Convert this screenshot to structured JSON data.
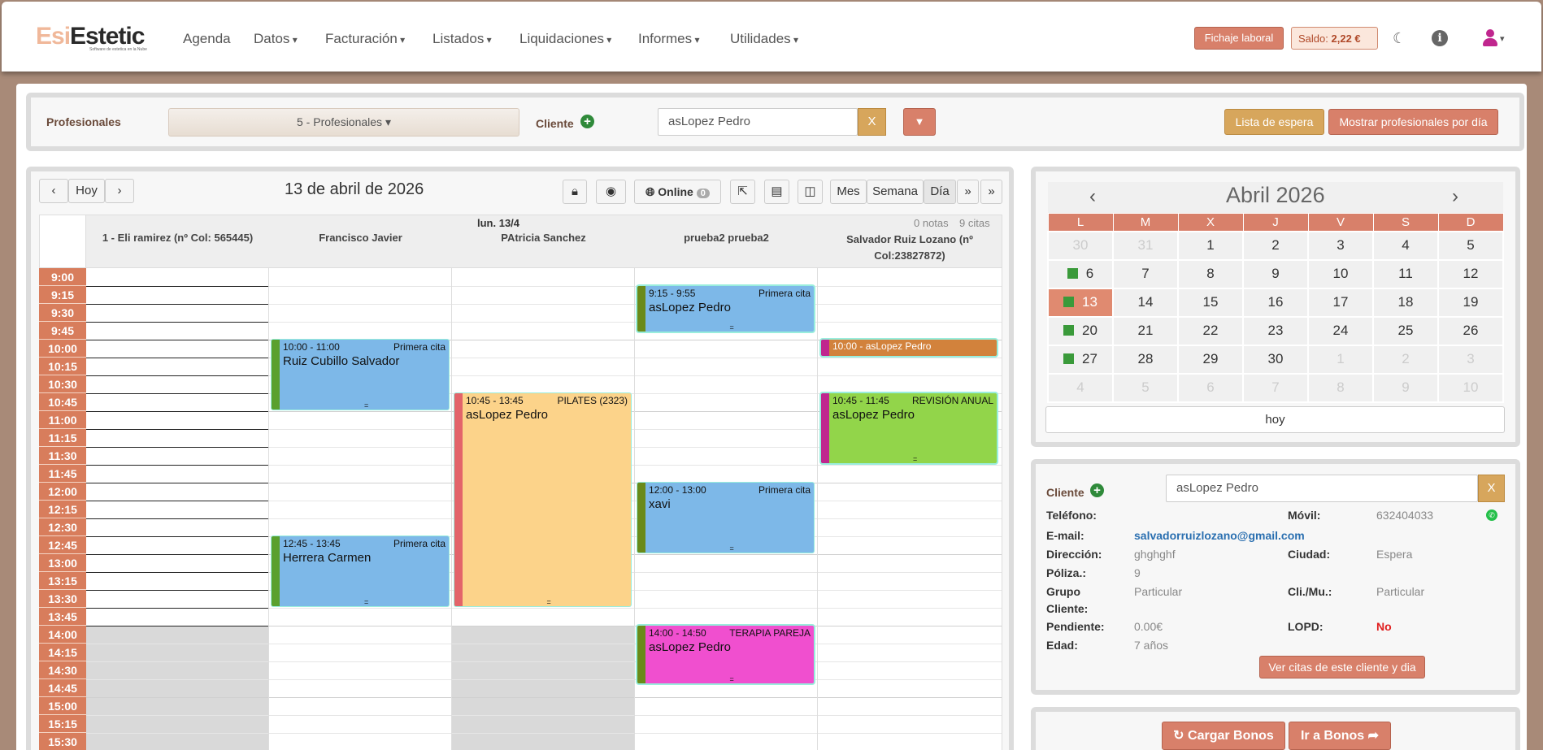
{
  "header": {
    "logo_a": "Esi",
    "logo_b": "Estetic",
    "logo_sub": "Software de estetica en la Nube",
    "nav": [
      "Agenda",
      "Datos",
      "Facturación",
      "Listados",
      "Liquidaciones",
      "Informes",
      "Utilidades"
    ],
    "fichaje": "Fichaje laboral",
    "saldo_label": "Saldo:",
    "saldo_value": "2,22 €"
  },
  "filter": {
    "profesionales_label": "Profesionales",
    "profesionales_select": "5 - Profesionales",
    "cliente_label": "Cliente",
    "cliente_value": "asLopez Pedro",
    "x": "X",
    "lista_espera": "Lista de espera",
    "mostrar": "Mostrar profesionales por día"
  },
  "agenda": {
    "hoy": "Hoy",
    "date_title": "13 de abril de 2026",
    "online": "Online",
    "online_count": "0",
    "views": [
      "Mes",
      "Semana",
      "Día"
    ],
    "day_label": "lun. 13/4",
    "notas": "0 notas",
    "citas": "9 citas",
    "professionals": [
      "1 - Eli ramirez (nº Col: 565445)",
      "Francisco Javier",
      "PAtricia Sanchez",
      "prueba2 prueba2",
      "Salvador Ruiz Lozano (nº Col:23827872)"
    ],
    "times": [
      "9:00",
      "9:15",
      "9:30",
      "9:45",
      "10:00",
      "10:15",
      "10:30",
      "10:45",
      "11:00",
      "11:15",
      "11:30",
      "11:45",
      "12:00",
      "12:15",
      "12:30",
      "12:45",
      "13:00",
      "13:15",
      "13:30",
      "13:45",
      "14:00",
      "14:15",
      "14:30",
      "14:45",
      "15:00",
      "15:15",
      "15:30"
    ],
    "events": [
      {
        "time": "10:00 - 11:00",
        "tag": "Primera cita",
        "name": "Ruiz Cubillo Salvador"
      },
      {
        "time": "12:45 - 13:45",
        "tag": "Primera cita",
        "name": "Herrera Carmen"
      },
      {
        "time": "10:45 - 13:45",
        "tag": "PILATES (2323)",
        "name": "asLopez Pedro"
      },
      {
        "time": "9:15 - 9:55",
        "tag": "Primera cita",
        "name": "asLopez Pedro"
      },
      {
        "time": "12:00 - 13:00",
        "tag": "Primera cita",
        "name": "xavi"
      },
      {
        "time": "14:00 - 14:50",
        "tag": "TERAPIA PAREJA",
        "name": "asLopez Pedro"
      },
      {
        "time": "10:00 - asLopez Pedro",
        "tag": "",
        "name": ""
      },
      {
        "time": "10:45 - 11:45",
        "tag": "REVISIÓN ANUAL",
        "name": "asLopez Pedro"
      }
    ]
  },
  "minical": {
    "title": "Abril 2026",
    "prev": "‹",
    "next": "›",
    "days": [
      "L",
      "M",
      "X",
      "J",
      "V",
      "S",
      "D"
    ],
    "weeks": [
      [
        "30",
        "31",
        "1",
        "2",
        "3",
        "4",
        "5"
      ],
      [
        "6",
        "7",
        "8",
        "9",
        "10",
        "11",
        "12"
      ],
      [
        "13",
        "14",
        "15",
        "16",
        "17",
        "18",
        "19"
      ],
      [
        "20",
        "21",
        "22",
        "23",
        "24",
        "25",
        "26"
      ],
      [
        "27",
        "28",
        "29",
        "30",
        "1",
        "2",
        "3"
      ],
      [
        "4",
        "5",
        "6",
        "7",
        "8",
        "9",
        "10"
      ]
    ],
    "hoy": "hoy"
  },
  "client": {
    "label": "Cliente",
    "value": "asLopez Pedro",
    "x": "X",
    "telefono_l": "Teléfono:",
    "movil_l": "Móvil:",
    "movil_v": "632404033",
    "email_l": "E-mail:",
    "email_v": "salvadorruizlozano@gmail.com",
    "direccion_l": "Dirección:",
    "direccion_v": "ghghghf",
    "ciudad_l": "Ciudad:",
    "ciudad_v": "Espera",
    "poliza_l": "Póliza.:",
    "poliza_v": "9",
    "grupo_l1": "Grupo",
    "grupo_l2": "Cliente:",
    "grupo_v": "Particular",
    "climu_l": "Cli./Mu.:",
    "climu_v": "Particular",
    "pendiente_l": "Pendiente:",
    "pendiente_v": "0.00€",
    "lopd_l": "LOPD:",
    "lopd_v": "No",
    "edad_l": "Edad:",
    "edad_v": "7 años",
    "ver_citas": "Ver citas de este cliente y dia"
  },
  "bonos": {
    "cargar": "Cargar Bonos",
    "ir": "Ir a Bonos"
  },
  "colors": {
    "accent": "#d8806a",
    "gold": "#d7a65c",
    "blue_event": "#7db8e8",
    "orange_event": "#fcd38a",
    "green_event": "#92d54a",
    "pink_event": "#f04fcf"
  }
}
